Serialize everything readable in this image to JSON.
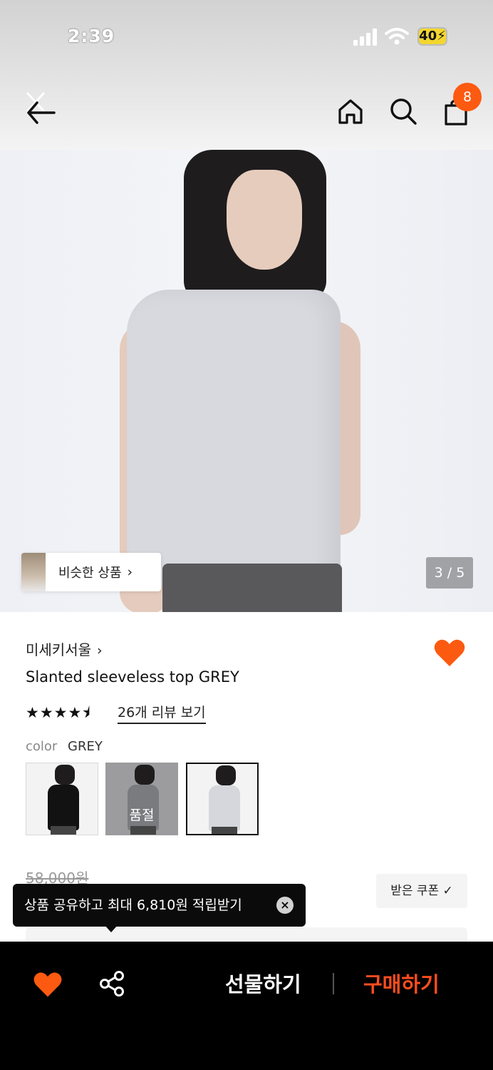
{
  "status_bar": {
    "time": "2:39",
    "battery": "40"
  },
  "header": {
    "cart_count": "8"
  },
  "gallery": {
    "similar_label": "비슷한 상품",
    "similar_chevron": "›",
    "counter": "3 / 5"
  },
  "product": {
    "brand": "미세키서울",
    "brand_chevron": "›",
    "title": "Slanted sleeveless top GREY",
    "rating": 4.5,
    "stars": "★★★★⯨",
    "review_link": "26개 리뷰 보기",
    "color_label": "color",
    "color_value": "GREY",
    "swatches": [
      {
        "name": "black",
        "soldout_label": ""
      },
      {
        "name": "charcoal",
        "soldout_label": "품절"
      },
      {
        "name": "grey",
        "soldout_label": ""
      }
    ],
    "original_price": "58,000원",
    "coupon_label": "받은 쿠폰 ✓"
  },
  "toast": {
    "message": "상품 공유하고 최대 6,810원 적립받기",
    "close": "×"
  },
  "bottom_bar": {
    "gift_label": "선물하기",
    "buy_label": "구매하기"
  },
  "colors": {
    "accent": "#FC5A11",
    "buy": "#FF4D1F",
    "bar": "#000000"
  },
  "icons": [
    "back-arrow-icon",
    "home-icon",
    "search-icon",
    "shopping-bag-icon",
    "heart-icon",
    "share-icon",
    "close-icon",
    "chevron-right-icon",
    "star-icon"
  ]
}
